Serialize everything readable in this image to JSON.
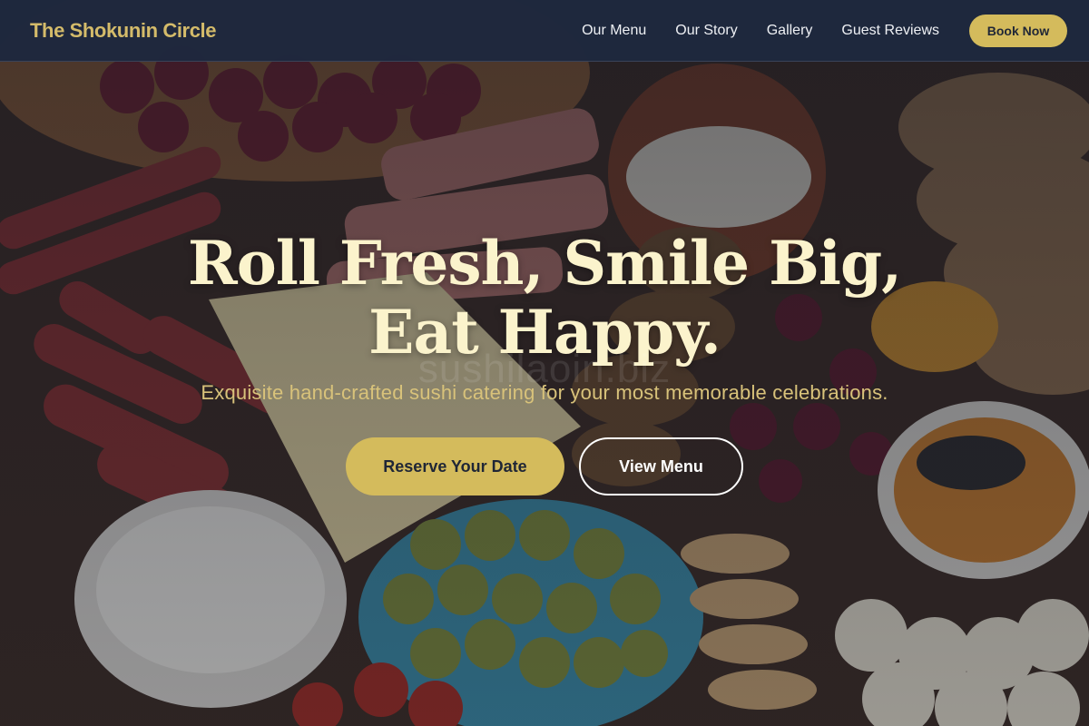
{
  "nav": {
    "brand": "The Shokunin Circle",
    "links": [
      "Our Menu",
      "Our Story",
      "Gallery",
      "Guest Reviews"
    ],
    "cta": "Book Now"
  },
  "hero": {
    "headline": "Roll Fresh, Smile Big, Eat Happy.",
    "subtitle": "Exquisite hand-crafted sushi catering for your most memorable celebrations.",
    "watermark": "sushilaoin.biz",
    "primary_cta": "Reserve Your Date",
    "secondary_cta": "View Menu",
    "background_image": "charcuterie-platter-photo"
  },
  "colors": {
    "accent_gold": "#d4bb5c",
    "nav_background": "#1e283e",
    "headline": "#fbf3cc"
  }
}
